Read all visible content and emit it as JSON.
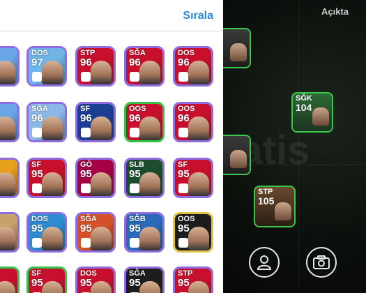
{
  "header": {
    "sort_label": "Sırala"
  },
  "status": {
    "label": "Açıkta"
  },
  "pitch": {
    "watermark": "fatis",
    "cards": [
      {
        "pos": "",
        "rating": ""
      },
      {
        "pos": "SĞK",
        "rating": "104"
      },
      {
        "pos": "",
        "rating": ""
      },
      {
        "pos": "STP",
        "rating": "105"
      }
    ]
  },
  "player_grid": [
    [
      {
        "pos": "",
        "rating": "",
        "color": "#6aa6e6"
      },
      {
        "pos": "DOS",
        "rating": "97",
        "color": "#6fb4e6"
      },
      {
        "pos": "STP",
        "rating": "96",
        "color": "#c8102e"
      },
      {
        "pos": "SĞA",
        "rating": "96",
        "color": "#c8102e"
      },
      {
        "pos": "DOS",
        "rating": "96",
        "color": "#c8102e"
      }
    ],
    [
      {
        "pos": "",
        "rating": "",
        "color": "#6aa6e6"
      },
      {
        "pos": "SĞA",
        "rating": "96",
        "color": "#8bb8e6"
      },
      {
        "pos": "SF",
        "rating": "96",
        "color": "#1c3f94"
      },
      {
        "pos": "OOS",
        "rating": "96",
        "color": "#c8102e"
      },
      {
        "pos": "OOS",
        "rating": "96",
        "color": "#c8102e"
      }
    ],
    [
      {
        "pos": "",
        "rating": "",
        "color": "#e6a01b"
      },
      {
        "pos": "SF",
        "rating": "95",
        "color": "#c8102e"
      },
      {
        "pos": "GÖ",
        "rating": "95",
        "color": "#a50044"
      },
      {
        "pos": "SLB",
        "rating": "95",
        "color": "#1b4d2e"
      },
      {
        "pos": "SF",
        "rating": "95",
        "color": "#c8102e"
      }
    ],
    [
      {
        "pos": "",
        "rating": "",
        "color": "#c8a26b"
      },
      {
        "pos": "DOS",
        "rating": "95",
        "color": "#2e8bd1"
      },
      {
        "pos": "SĞA",
        "rating": "95",
        "color": "#d6502a"
      },
      {
        "pos": "SĞB",
        "rating": "95",
        "color": "#2a6ab8"
      },
      {
        "pos": "OOS",
        "rating": "95",
        "color": "#1c1c1c"
      }
    ],
    [
      {
        "pos": "",
        "rating": "",
        "color": "#c8102e"
      },
      {
        "pos": "SF",
        "rating": "95",
        "color": "#c8102e"
      },
      {
        "pos": "DOS",
        "rating": "95",
        "color": "#c8102e"
      },
      {
        "pos": "SĞA",
        "rating": "95",
        "color": "#1c1c1c"
      },
      {
        "pos": "STP",
        "rating": "95",
        "color": "#c8102e"
      }
    ]
  ],
  "icons": {
    "profile": "person-icon",
    "camera": "camera-icon"
  }
}
